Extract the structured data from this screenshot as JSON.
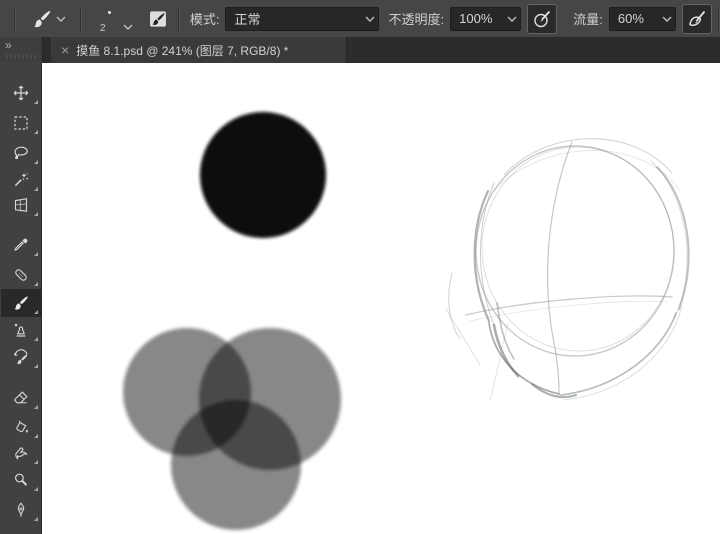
{
  "options_bar": {
    "brush_preset": {
      "size_value": "2"
    },
    "mode_label": "模式:",
    "mode_value": "正常",
    "opacity_label": "不透明度:",
    "opacity_value": "100%",
    "flow_label": "流量:",
    "flow_value": "60%",
    "pressure_opacity_button": "tablet-pressure-opacity-icon",
    "airbrush_button": "airbrush-icon"
  },
  "tab_bar": {
    "expand_glyph": "»",
    "active_tab": {
      "close_glyph": "×",
      "title": "摸鱼 8.1.psd @ 241% (图层 7, RGB/8) *"
    }
  },
  "sidebar": {
    "selected_tool": "brush",
    "tools": [
      "move",
      "rectangular-marquee",
      "lasso",
      "magic-wand",
      "perspective-crop",
      "eyedropper",
      "spot-healing-brush",
      "brush",
      "clone-stamp",
      "history-brush",
      "eraser",
      "paint-bucket",
      "smudge",
      "dodge",
      "pen"
    ]
  },
  "canvas": {
    "zoom_percent": "241%",
    "layer": "图层 7",
    "mode": "RGB/8",
    "artwork": [
      "black-brush-dab",
      "three-overlapping-gray-dabs",
      "pencil-head-sketch"
    ]
  },
  "colors": {
    "options_bar_bg": "#464646",
    "tab_bar_bg": "#2c2c2c",
    "active_tab_bg": "#3a3a3a",
    "tools_panel_bg": "#414141",
    "field_bg": "#272727",
    "ui_text": "#cccccc",
    "canvas_bg": "#ffffff",
    "ink_black": "#000000",
    "wash_gray": "#8a8a8a"
  }
}
